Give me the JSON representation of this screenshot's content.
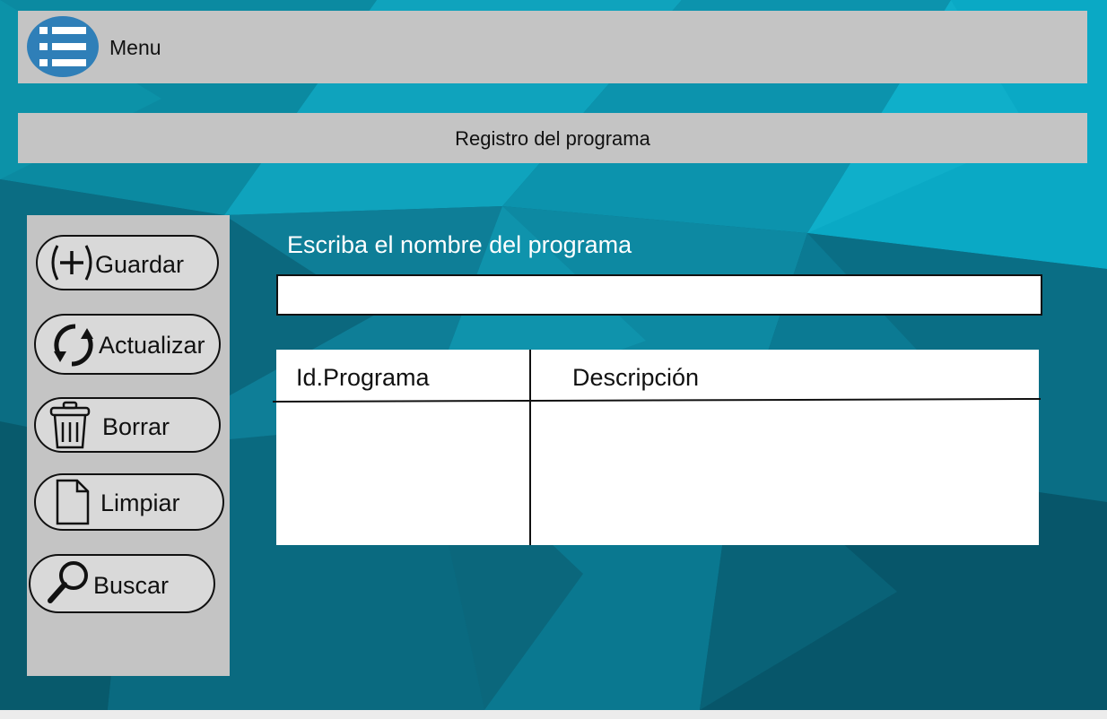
{
  "header": {
    "menu_label": "Menu",
    "menu_icon": "list-icon"
  },
  "title": "Registro del programa",
  "sidebar": {
    "buttons": [
      {
        "label": "Guardar",
        "icon": "plus-circle-icon"
      },
      {
        "label": "Actualizar",
        "icon": "refresh-icon"
      },
      {
        "label": "Borrar",
        "icon": "trash-icon"
      },
      {
        "label": "Limpiar",
        "icon": "document-icon"
      },
      {
        "label": "Buscar",
        "icon": "search-icon"
      }
    ]
  },
  "form": {
    "prompt": "Escriba el nombre del programa",
    "name_value": "",
    "name_placeholder": ""
  },
  "table": {
    "columns": [
      "Id.Programa",
      "Descripción"
    ],
    "rows": []
  },
  "colors": {
    "panel": "#c4c4c4",
    "button": "#d9d9d9",
    "menu_icon": "#2f7fb8",
    "background": "#0a6f84"
  }
}
